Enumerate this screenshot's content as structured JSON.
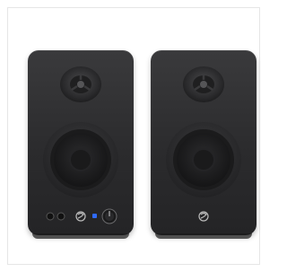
{
  "product": {
    "description_icons": {
      "tweeter": "tweeter-dome-icon",
      "woofer": "woofer-cone-icon",
      "brand": "brand-s-logo-icon",
      "volume": "volume-knob-icon",
      "power_led": "power-led-icon",
      "aux": "aux-input-jack-icon",
      "headphone": "headphone-output-jack-icon"
    },
    "colors": {
      "cabinet": "#2f2f31",
      "cone": "#1d1d1e",
      "led": "#2f6bff",
      "background": "#ffffff"
    }
  }
}
